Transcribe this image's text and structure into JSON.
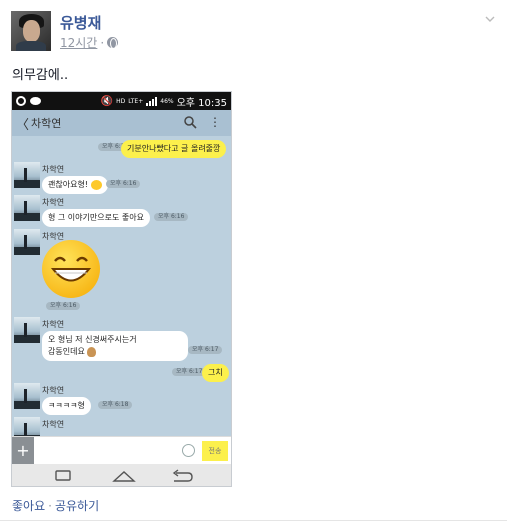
{
  "post": {
    "author": "유병재",
    "time": "12시간",
    "text": "의무감에..",
    "actions": {
      "like": "좋아요",
      "share": "공유하기"
    }
  },
  "phone": {
    "status_bar": {
      "lte": "LTE+",
      "battery": "46%",
      "clock": "오후 10:35"
    },
    "app_bar": {
      "back": "〈",
      "title": "차학연"
    },
    "messages": [
      {
        "from": "me",
        "text": "기분안나빴다고 글 올려줄깡",
        "time": "오후 6:15"
      },
      {
        "from": "차학연",
        "text": "괜찮아요형!",
        "time": "오후 6:16"
      },
      {
        "from": "차학연",
        "text": "형 그 이야기만으로도 좋아요",
        "time": "오후 6:16"
      },
      {
        "from": "차학연",
        "text": "",
        "emoticon": "grin-emoticon",
        "time": "오후 6:16"
      },
      {
        "from": "차학연",
        "text": "오 형님 저 신경써주시는거",
        "text2": "감동인데요",
        "time": "오후 6:17"
      },
      {
        "from": "me",
        "text": "그치",
        "time": "오후 6:17"
      },
      {
        "from": "차학연",
        "text": "ㅋㅋㅋㅋ형",
        "time": "오후 6:18"
      }
    ],
    "input": {
      "send_label": "전송"
    }
  },
  "colors": {
    "link": "#3b5998",
    "chat_bg": "#bcd0de",
    "my_bubble": "#fcf04c"
  }
}
